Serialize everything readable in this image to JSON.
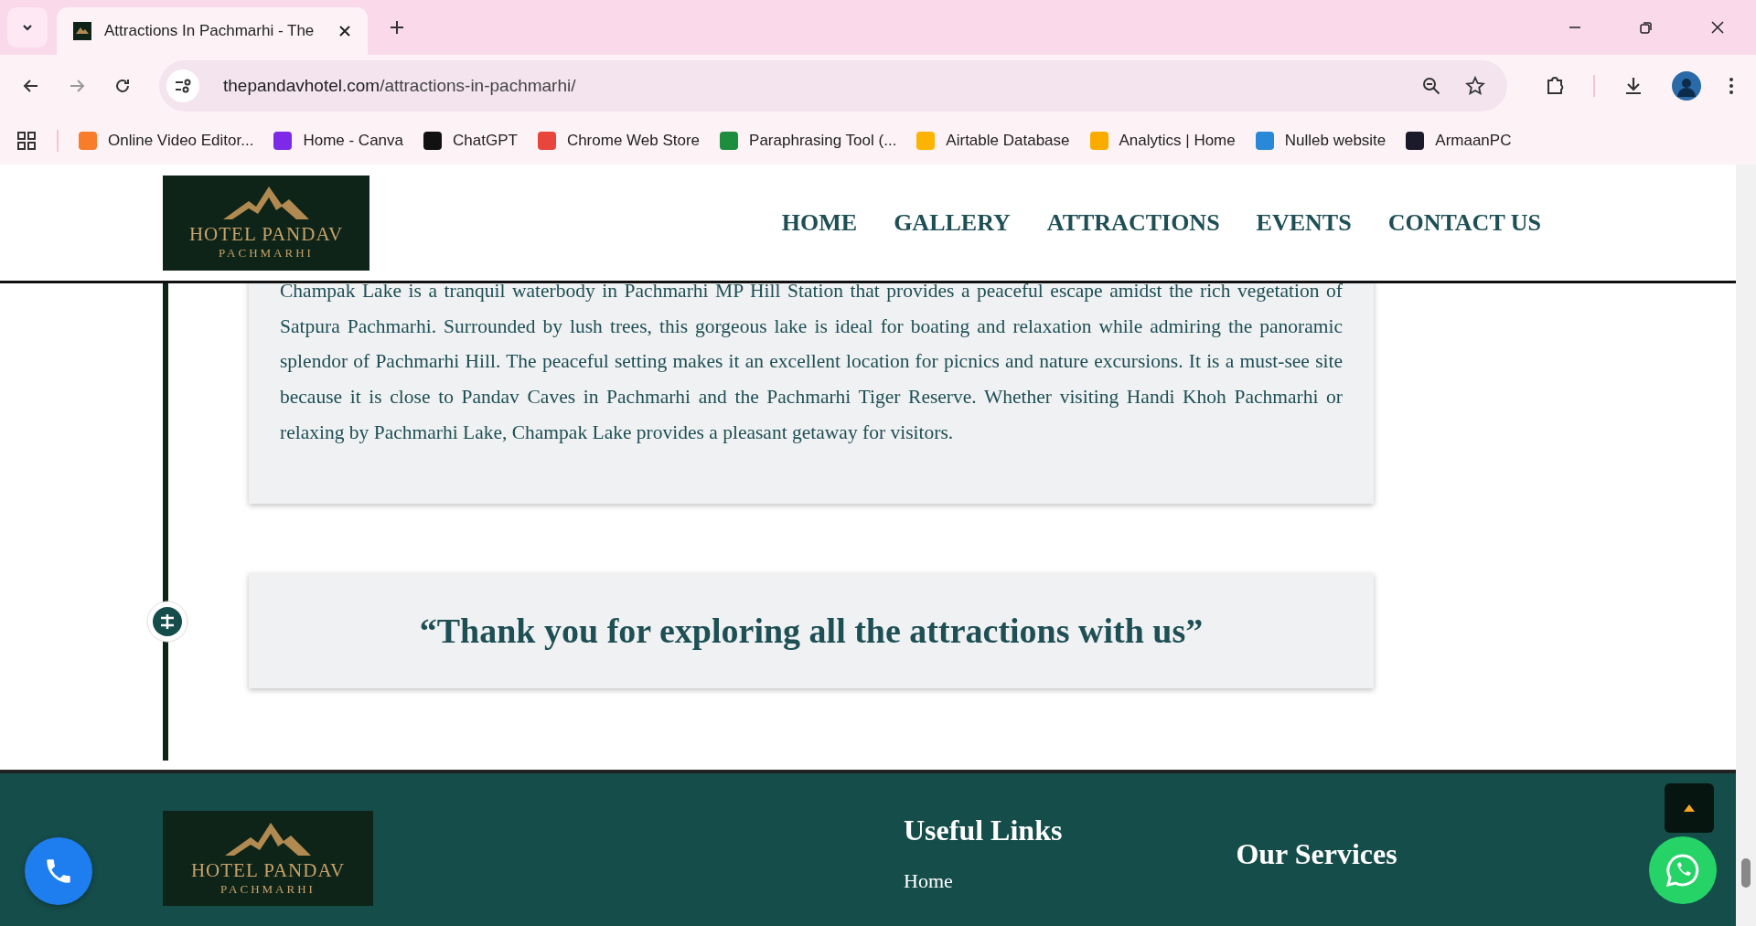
{
  "browser": {
    "tab_title": "Attractions In Pachmarhi - The",
    "url_domain": "thepandavhotel.com",
    "url_path": "/attractions-in-pachmarhi/",
    "bookmarks": [
      {
        "label": "Online Video Editor...",
        "color": "#f97c2a"
      },
      {
        "label": "Home - Canva",
        "color": "#7d2ae8"
      },
      {
        "label": "ChatGPT",
        "color": "#111111"
      },
      {
        "label": "Chrome Web Store",
        "color": "#e8453c"
      },
      {
        "label": "Paraphrasing Tool (...",
        "color": "#1e8e3e"
      },
      {
        "label": "Airtable Database",
        "color": "#fcb400"
      },
      {
        "label": "Analytics | Home",
        "color": "#f9ab00"
      },
      {
        "label": "Nulleb website",
        "color": "#2a88d8"
      },
      {
        "label": "ArmaanPC",
        "color": "#1a1a2a"
      }
    ]
  },
  "header": {
    "logo": {
      "name": "HOTEL PANDAV",
      "place": "PACHMARHI"
    },
    "nav": [
      "HOME",
      "GALLERY",
      "ATTRACTIONS",
      "EVENTS",
      "CONTACT US"
    ]
  },
  "attraction": {
    "lines": [
      "Champak Lake is a tranquil waterbody in Pachmarhi MP Hill Station that provides a peaceful escape amidst the rich vegetation of Satpura Pachmarhi. Surrounded by lush trees, this gorgeous lake is ideal for boating and relaxation while admiring the panoramic splendor of Pachmarhi Hill. The peaceful setting makes it an excellent location for picnics and nature excursions. It is a must-see site because it is close to Pandav Caves in Pachmarhi and the Pachmarhi Tiger Reserve. Whether visiting Handi Khoh Pachmarhi or relaxing by Pachmarhi Lake, Champak Lake provides a pleasant getaway for visitors."
    ]
  },
  "closing_quote": "“Thank you for exploring all the attractions with us”",
  "footer": {
    "logo": {
      "name": "HOTEL PANDAV",
      "place": "PACHMARHI"
    },
    "useful_links_title": "Useful Links",
    "useful_links": [
      "Home"
    ],
    "services_title": "Our Services"
  }
}
